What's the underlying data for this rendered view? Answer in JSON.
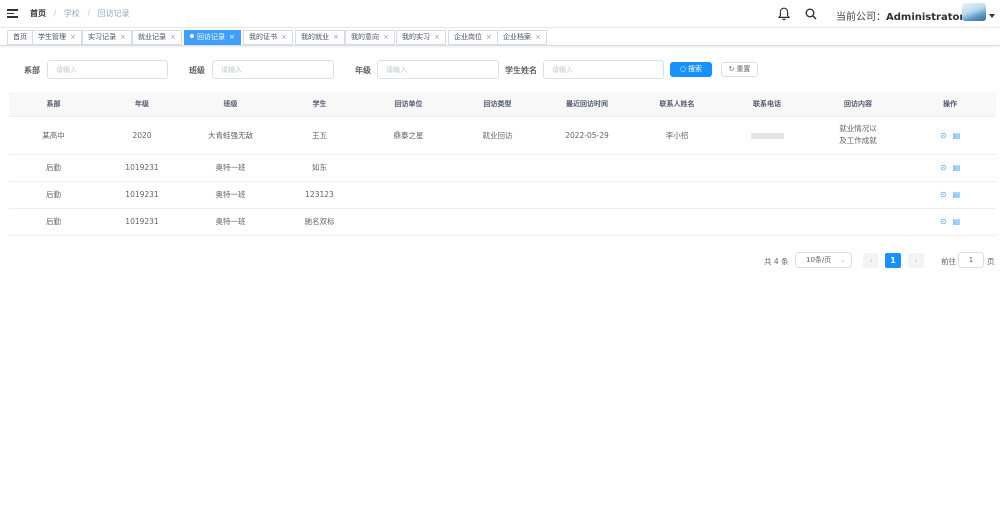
{
  "header": {
    "breadcrumb": [
      "首页",
      "学校",
      "回访记录"
    ],
    "company_label": "当前公司：",
    "company_name": "Administrator"
  },
  "tags": [
    {
      "label": "首页",
      "closable": false,
      "active": false
    },
    {
      "label": "学生管理",
      "closable": true,
      "active": false
    },
    {
      "label": "实习记录",
      "closable": true,
      "active": false
    },
    {
      "label": "就业记录",
      "closable": true,
      "active": false
    },
    {
      "label": "回访记录",
      "closable": true,
      "active": true
    },
    {
      "label": "我的证书",
      "closable": true,
      "active": false
    },
    {
      "label": "我的就业",
      "closable": true,
      "active": false
    },
    {
      "label": "我的意向",
      "closable": true,
      "active": false
    },
    {
      "label": "我的实习",
      "closable": true,
      "active": false
    },
    {
      "label": "企业岗位",
      "closable": true,
      "active": false
    },
    {
      "label": "企业档案",
      "closable": true,
      "active": false
    }
  ],
  "filters": {
    "department_label": "系部",
    "class_label": "班级",
    "grade_label": "年级",
    "student_label": "学生姓名",
    "placeholder": "请输入",
    "search_btn": "搜索",
    "reset_btn": "重置"
  },
  "table": {
    "columns": [
      "系部",
      "年级",
      "班级",
      "学生",
      "回访单位",
      "回访类型",
      "最近回访时间",
      "联系人姓名",
      "联系电话",
      "回访内容",
      "操作"
    ],
    "rows": [
      [
        "某高中",
        "2020",
        "大青蛙强无敌",
        "王五",
        "鼎泰之星",
        "就业回访",
        "2022-05-29",
        "李小招",
        "",
        "就业情况以及工作成就"
      ],
      [
        "后勤",
        "1019231",
        "奥特一班",
        "如东",
        "",
        "",
        "",
        "",
        "",
        ""
      ],
      [
        "后勤",
        "1019231",
        "奥特一班",
        "123123",
        "",
        "",
        "",
        "",
        "",
        ""
      ],
      [
        "后勤",
        "1019231",
        "奥特一班",
        "驰名双标",
        "",
        "",
        "",
        "",
        "",
        ""
      ]
    ]
  },
  "pagination": {
    "total_text": "共 4 条",
    "page_size": "10条/页",
    "current_page": "1",
    "goto_label": "前往",
    "goto_value": "1",
    "page_suffix": "页"
  },
  "colors": {
    "primary": "#1890ff",
    "active_tag": "#409eff"
  }
}
